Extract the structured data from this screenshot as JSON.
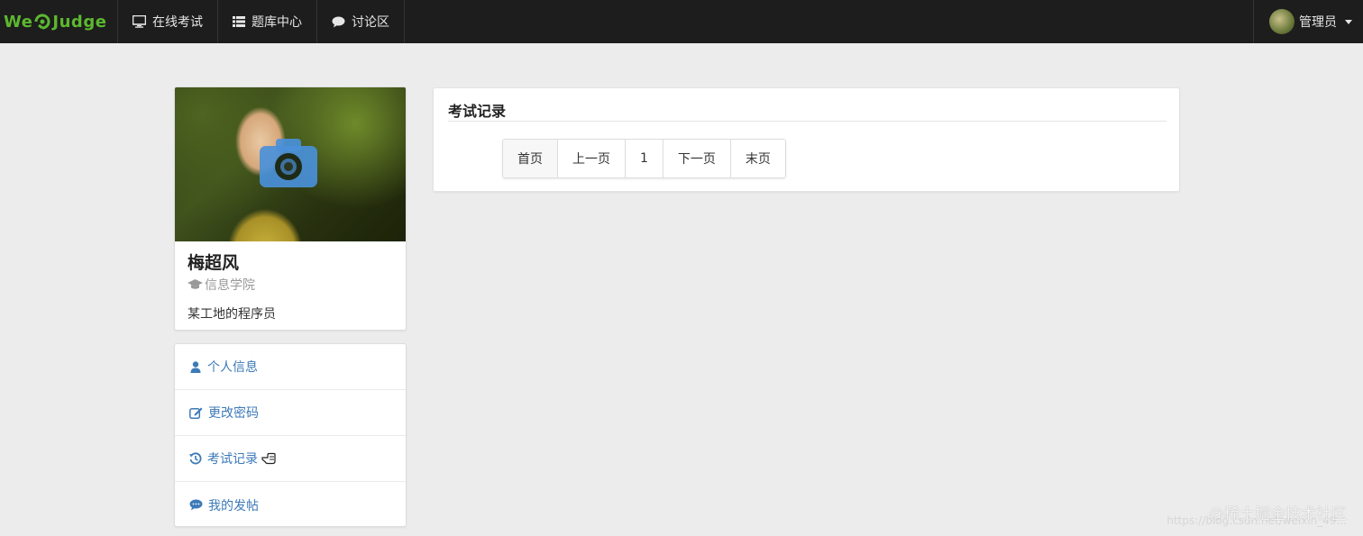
{
  "navbar": {
    "brand_prefix": "We",
    "brand_suffix": "Judge",
    "items": [
      {
        "label": "在线考试",
        "icon": "monitor-icon"
      },
      {
        "label": "题库中心",
        "icon": "list-icon"
      },
      {
        "label": "讨论区",
        "icon": "comment-icon"
      }
    ],
    "user_label": "管理员"
  },
  "profile": {
    "name": "梅超风",
    "school": "信息学院",
    "bio": "某工地的程序员"
  },
  "side_menu": {
    "items": [
      {
        "label": "个人信息",
        "icon": "user-icon"
      },
      {
        "label": "更改密码",
        "icon": "edit-icon"
      },
      {
        "label": "考试记录",
        "icon": "history-icon"
      },
      {
        "label": "我的发帖",
        "icon": "comment-icon"
      }
    ]
  },
  "main": {
    "title": "考试记录",
    "pagination": {
      "first": "首页",
      "prev": "上一页",
      "current": "1",
      "next": "下一页",
      "last": "末页"
    }
  },
  "watermark": {
    "text": "@稀土掘金技术社区",
    "url": "https://blog.csdn.net/weixin_49..."
  },
  "colors": {
    "navbar_bg": "#1d1d1d",
    "brand_green": "#5cb82f",
    "link_blue": "#3d7ab8",
    "page_bg": "#ececec",
    "camera_blue": "#4a90d9"
  }
}
